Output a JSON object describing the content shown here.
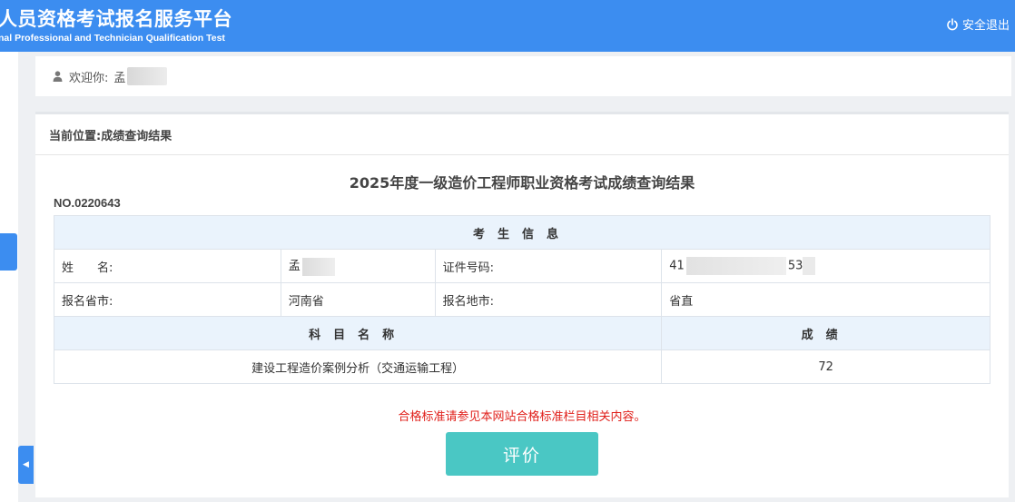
{
  "header": {
    "title": "人员资格考试报名服务平台",
    "subtitle": "nal Professional and Technician Qualification Test",
    "logout_label": "安全退出",
    "logout_icon": "power-icon",
    "background": "#3c8df0"
  },
  "welcome": {
    "label": "欢迎你:",
    "name_prefix": "孟",
    "user_icon": "user-icon"
  },
  "breadcrumb": {
    "text": "当前位置:成绩查询结果"
  },
  "result": {
    "title": "2025年度一级造价工程师职业资格考试成绩查询结果",
    "cert_no": "NO.0220643",
    "section_header": "考生信息",
    "fields": {
      "name_label": "姓　　名:",
      "name_value": "孟",
      "id_label": "证件号码:",
      "id_prefix": "41",
      "id_suffix": "53",
      "province_label": "报名省市:",
      "province_value": "河南省",
      "city_label": "报名地市:",
      "city_value": "省直"
    },
    "columns": {
      "subject": "科目名称",
      "score": "成绩"
    },
    "rows": [
      {
        "subject": "建设工程造价案例分析（交通运输工程）",
        "score": "72"
      }
    ]
  },
  "notice": "合格标准请参见本网站合格标准栏目相关内容。",
  "eval_button": "评价",
  "colors": {
    "accent": "#3c8df0",
    "table_header": "#eaf3fc",
    "notice": "#e0201b",
    "button": "#4ac7c4"
  }
}
